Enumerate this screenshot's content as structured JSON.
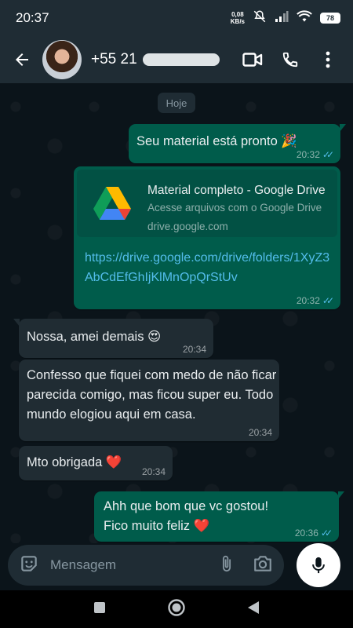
{
  "status": {
    "time": "20:37",
    "net_speed_value": "0,08",
    "net_speed_unit": "KB/s",
    "battery": "78"
  },
  "header": {
    "contact_name": "+55 21",
    "icons": [
      "back-arrow-icon",
      "video-call-icon",
      "phone-icon",
      "more-vert-icon"
    ]
  },
  "chat": {
    "day_label": "Hoje",
    "messages": [
      {
        "dir": "out",
        "text": "Seu material está pronto 🎉",
        "time": "20:32",
        "status": "read"
      },
      {
        "dir": "out",
        "preview_title": "Material completo - Google Drive",
        "preview_desc": "Acesse arquivos com o Google Drive",
        "preview_domain": "drive.google.com",
        "link": "https://drive.google.com/drive/folders/1XyZ3AbCdEfGhIjKlMnOpQrStUv",
        "time": "20:32",
        "status": "read"
      },
      {
        "dir": "in",
        "text": "Nossa, amei demais 😍",
        "time": "20:34"
      },
      {
        "dir": "in",
        "text": "Confesso que fiquei com medo de não ficar parecida comigo, mas ficou super eu. Todo mundo elogiou aqui em casa.",
        "time": "20:34"
      },
      {
        "dir": "in",
        "text": "Mto obrigada ❤️",
        "time": "20:34"
      },
      {
        "dir": "out",
        "text": "Ahh que bom que vc gostou! Fico muito feliz ❤️",
        "time": "20:36",
        "status": "read"
      }
    ]
  },
  "input": {
    "placeholder": "Mensagem"
  },
  "colors": {
    "outgoing_bubble": "#005c4b",
    "incoming_bubble": "#202c33",
    "link": "#53bdeb",
    "read_ticks": "#53bdeb",
    "background": "#0b141a"
  }
}
